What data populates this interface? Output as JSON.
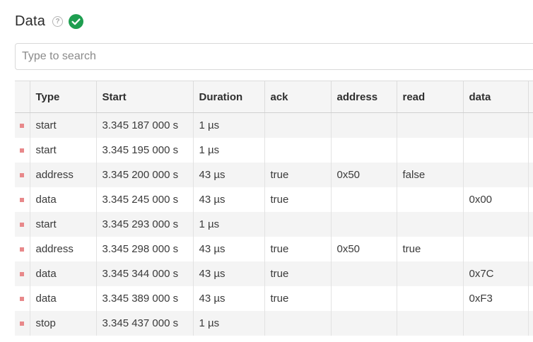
{
  "header": {
    "title": "Data",
    "help_icon": "question-circle-icon",
    "status_icon": "check-circle-icon",
    "status_color": "#1e9e50"
  },
  "search": {
    "placeholder": "Type to search",
    "value": ""
  },
  "table": {
    "marker_color": "#e8888a",
    "columns": [
      "Type",
      "Start",
      "Duration",
      "ack",
      "address",
      "read",
      "data",
      ""
    ],
    "rows": [
      [
        "start",
        "3.345 187 000 s",
        "1 µs",
        "",
        "",
        "",
        "",
        ""
      ],
      [
        "start",
        "3.345 195 000 s",
        "1 µs",
        "",
        "",
        "",
        "",
        ""
      ],
      [
        "address",
        "3.345 200 000 s",
        "43 µs",
        "true",
        "0x50",
        "false",
        "",
        ""
      ],
      [
        "data",
        "3.345 245 000 s",
        "43 µs",
        "true",
        "",
        "",
        "0x00",
        ""
      ],
      [
        "start",
        "3.345 293 000 s",
        "1 µs",
        "",
        "",
        "",
        "",
        ""
      ],
      [
        "address",
        "3.345 298 000 s",
        "43 µs",
        "true",
        "0x50",
        "true",
        "",
        ""
      ],
      [
        "data",
        "3.345 344 000 s",
        "43 µs",
        "true",
        "",
        "",
        "0x7C",
        ""
      ],
      [
        "data",
        "3.345 389 000 s",
        "43 µs",
        "true",
        "",
        "",
        "0xF3",
        ""
      ],
      [
        "stop",
        "3.345 437 000 s",
        "1 µs",
        "",
        "",
        "",
        "",
        ""
      ]
    ]
  }
}
